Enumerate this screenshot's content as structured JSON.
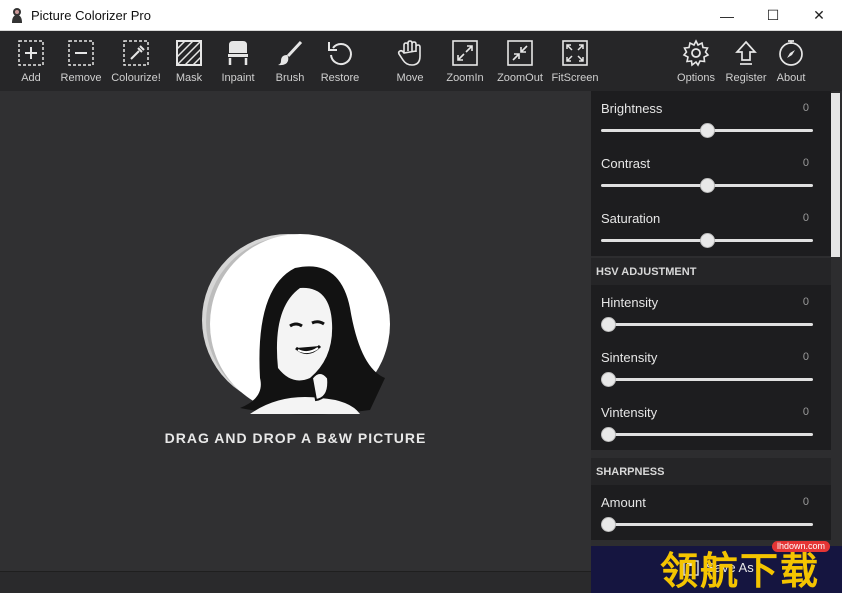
{
  "window": {
    "title": "Picture Colorizer Pro",
    "minimize_glyph": "—",
    "maximize_glyph": "☐",
    "close_glyph": "✕"
  },
  "toolbar": {
    "add": "Add",
    "remove": "Remove",
    "colourize": "Colourize!",
    "mask": "Mask",
    "inpaint": "Inpaint",
    "brush": "Brush",
    "restore": "Restore",
    "move": "Move",
    "zoomin": "ZoomIn",
    "zoomout": "ZoomOut",
    "fitscreen": "FitScreen",
    "options": "Options",
    "register": "Register",
    "about": "About"
  },
  "canvas": {
    "drop_text": "DRAG AND DROP A B&W PICTURE"
  },
  "panel": {
    "sliders_top": [
      {
        "name": "Brightness",
        "value": "0",
        "level": 0.5
      },
      {
        "name": "Contrast",
        "value": "0",
        "level": 0.5
      },
      {
        "name": "Saturation",
        "value": "0",
        "level": 0.5
      }
    ],
    "hsv_header": "HSV ADJUSTMENT",
    "hsv_sliders": [
      {
        "name": "Hintensity",
        "value": "0",
        "level": 0
      },
      {
        "name": "Sintensity",
        "value": "0",
        "level": 0
      },
      {
        "name": "Vintensity",
        "value": "0",
        "level": 0
      }
    ],
    "sharpness_header": "SHARPNESS",
    "sharpness_sliders": [
      {
        "name": "Amount",
        "value": "0",
        "level": 0
      }
    ],
    "save_label": "Save As"
  },
  "watermark": {
    "logo": "领航下载",
    "site": "lhdown.com"
  },
  "colors": {
    "accent": "#f4c400",
    "panel_dark": "#1d1d1f",
    "save_bar": "#151540"
  }
}
